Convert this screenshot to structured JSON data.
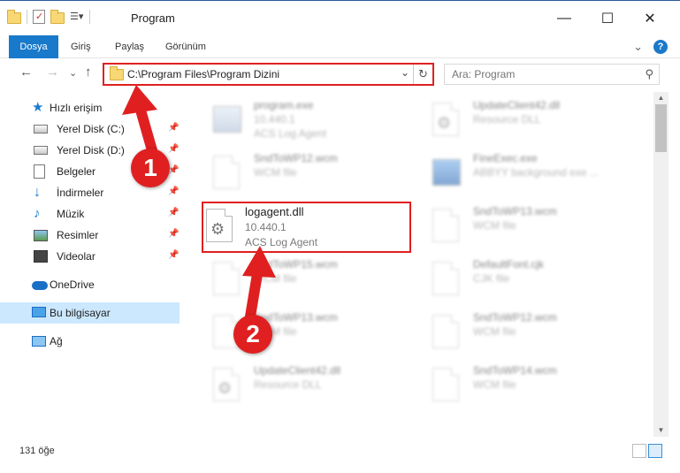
{
  "window": {
    "title": "Program",
    "minimize": "—",
    "maximize": "☐",
    "close": "✕"
  },
  "ribbon": {
    "tabs": [
      "Dosya",
      "Giriş",
      "Paylaş",
      "Görünüm"
    ],
    "expand": "⌄",
    "help": "?"
  },
  "nav": {
    "back": "←",
    "forward": "→",
    "recent": "⌄",
    "up": "↑"
  },
  "address": {
    "path": "C:\\Program Files\\Program Dizini",
    "dropdown": "⌄",
    "refresh": "↻"
  },
  "search": {
    "placeholder": "Ara: Program",
    "icon": "⚲"
  },
  "sidebar": {
    "pin": "📌",
    "quick_access": "Hızlı erişim",
    "items": [
      {
        "label": "Yerel Disk (C:)",
        "icon": "drive-icon"
      },
      {
        "label": "Yerel Disk (D:)",
        "icon": "drive-icon"
      },
      {
        "label": "Belgeler",
        "icon": "documents-icon"
      },
      {
        "label": "İndirmeler",
        "icon": "downloads-icon"
      },
      {
        "label": "Müzik",
        "icon": "music-icon"
      },
      {
        "label": "Resimler",
        "icon": "pictures-icon"
      },
      {
        "label": "Videolar",
        "icon": "videos-icon"
      }
    ],
    "onedrive": "OneDrive",
    "this_pc": "Bu bilgisayar",
    "network": "Ağ"
  },
  "files": [
    {
      "name": "program.exe",
      "line2": "10.440.1",
      "line3": "ACS Log Agent",
      "icon": "exe-icon"
    },
    {
      "name": "UpdateClient42.dll",
      "line2": "Resource DLL",
      "line3": "",
      "icon": "dll-icon"
    },
    {
      "name": "SndToWP12.wcm",
      "line2": "WCM file",
      "line3": "",
      "icon": "file-icon"
    },
    {
      "name": "FineExec.exe",
      "line2": "ABBYY background exe ...",
      "line3": "",
      "icon": "exe-icon"
    },
    {
      "name": "logagent.dll",
      "line2": "10.440.1",
      "line3": "ACS Log Agent",
      "icon": "dll-icon"
    },
    {
      "name": "SndToWP13.wcm",
      "line2": "WCM file",
      "line3": "",
      "icon": "file-icon"
    },
    {
      "name": "SndToWP15.wcm",
      "line2": "WCM file",
      "line3": "",
      "icon": "file-icon"
    },
    {
      "name": "DefaultFont.cjk",
      "line2": "CJK file",
      "line3": "",
      "icon": "file-icon"
    },
    {
      "name": "SndToWP13.wcm",
      "line2": "WCM file",
      "line3": "",
      "icon": "file-icon"
    },
    {
      "name": "SndToWP12.wcm",
      "line2": "WCM file",
      "line3": "",
      "icon": "file-icon"
    },
    {
      "name": "UpdateClient42.dll",
      "line2": "Resource DLL",
      "line3": "",
      "icon": "dll-icon"
    },
    {
      "name": "SndToWP14.wcm",
      "line2": "WCM file",
      "line3": "",
      "icon": "file-icon"
    }
  ],
  "annotations": {
    "step1": "1",
    "step2": "2",
    "color": "#e02020"
  },
  "status": {
    "count": "131 öğe"
  }
}
